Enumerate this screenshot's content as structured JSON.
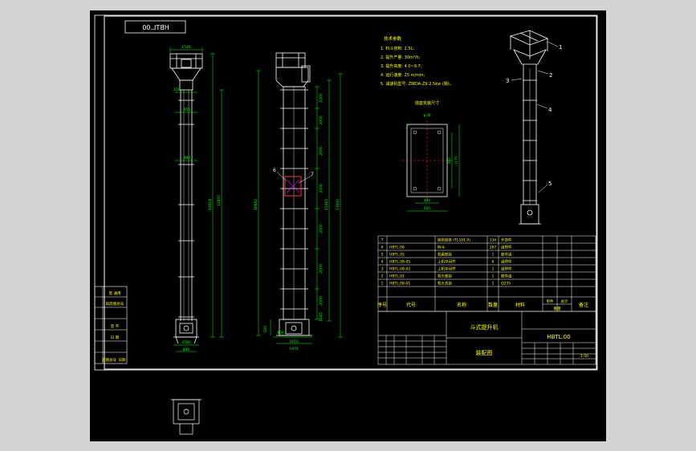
{
  "colors": {
    "background": "#d4d4d4",
    "drawing_area": "#000000",
    "line": "#ffffff",
    "dimension": "#00ff00",
    "text": "#ffff00",
    "centerline": "#ff3333",
    "accent": "#ff00ff"
  },
  "frame": {
    "drawing_number_mirrored": "HBTL.00"
  },
  "dimensions": {
    "front_top_width": "1546",
    "front_head": "250",
    "front_mid_1": "455",
    "front_mid_2": "480",
    "front_total_1": "14918",
    "front_total_2": "12800",
    "front_bottom_1": "3780",
    "front_bottom_2": "840",
    "side_total_1": "16692",
    "side_total_2": "15465",
    "side_total_3": "13000",
    "side_seg_1": "1000",
    "side_seg_2": "2000",
    "side_seg_3": "2000",
    "side_seg_4": "2000",
    "side_seg_5": "2000",
    "side_seg_6": "2000",
    "side_seg_7": "2000",
    "side_seg_8": "1645",
    "side_bottom_1": "400",
    "side_bottom_2": "1650",
    "side_bottom_3": "1976",
    "side_left_1": "320",
    "detail_top": "φ 38",
    "detail_1": "860",
    "detail_2": "1175",
    "detail_3": "480",
    "detail_4": "620"
  },
  "callouts": {
    "side_6": "6",
    "side_7": "7",
    "iso_1": "1",
    "iso_2": "2",
    "iso_3": "3",
    "iso_4": "4",
    "iso_5": "5"
  },
  "tech_params": {
    "title": "技术参数",
    "items": [
      "1. 料斗容积: 2.5L;",
      "2. 提升产量: 30m³/h;",
      "3. 提升高度: 4.0~9.7;",
      "4. 运行速度: 25 m/min;",
      "5. 减速机型号: ZWDA-Z9-2.5kw (钢)。"
    ]
  },
  "detail_title": "底座安装尺寸",
  "bom": {
    "rows": [
      {
        "no": "7",
        "code": "",
        "name": "链带链条 (TL101.0)",
        "qty": "134",
        "material": "外协件"
      },
      {
        "no": "6",
        "code": "HBTL.06",
        "name": "料斗",
        "qty": "267",
        "material": "组焊件"
      },
      {
        "no": "5",
        "code": "HBTL.05",
        "name": "机尾部装",
        "qty": "1",
        "material": "部件组"
      },
      {
        "no": "4",
        "code": "HBTL.08-05",
        "name": "上机中间节",
        "qty": "6",
        "material": "组焊件"
      },
      {
        "no": "3",
        "code": "HBTL.08-02",
        "name": "上机中间节",
        "qty": "1",
        "material": "组焊件"
      },
      {
        "no": "2",
        "code": "HBTL.01",
        "name": "机头部装",
        "qty": "1",
        "material": "部件组"
      },
      {
        "no": "1",
        "code": "HBTL.08-01",
        "name": "机头总装",
        "qty": "1",
        "material": "Q235"
      }
    ],
    "headers": {
      "no": "序号",
      "code": "代号",
      "name": "名称",
      "qty": "数量",
      "material": "材料",
      "single": "单件",
      "total": "总计",
      "weight": "重量",
      "remark": "备注"
    }
  },
  "title_block": {
    "product_name": "斗式提升机",
    "drawing_number": "HBTL.00",
    "drawing_type": "装配图",
    "scale": "1:50"
  },
  "side_panel": {
    "rows": [
      "借 通用",
      "旧底图总号",
      "",
      "签 字",
      "日 期",
      "底图总号",
      "日期"
    ]
  }
}
